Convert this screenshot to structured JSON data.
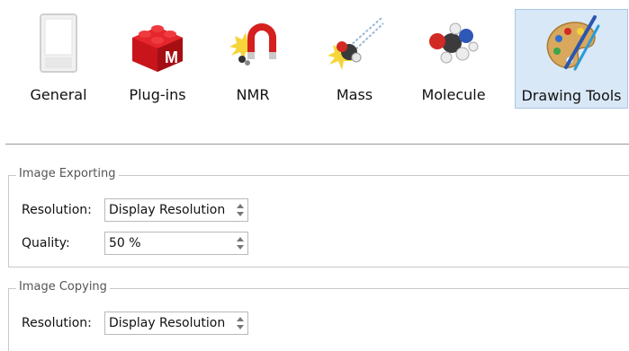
{
  "toolbar": {
    "items": [
      {
        "label": "General",
        "icon": "general-icon",
        "selected": false
      },
      {
        "label": "Plug-ins",
        "icon": "plugins-icon",
        "selected": false
      },
      {
        "label": "NMR",
        "icon": "nmr-icon",
        "selected": false
      },
      {
        "label": "Mass",
        "icon": "mass-icon",
        "selected": false
      },
      {
        "label": "Molecule",
        "icon": "molecule-icon",
        "selected": false
      },
      {
        "label": "Drawing Tools",
        "icon": "drawing-tools-icon",
        "selected": true
      }
    ]
  },
  "image_exporting": {
    "title": "Image Exporting",
    "resolution_label": "Resolution:",
    "resolution_value": "Display Resolution",
    "quality_label": "Quality:",
    "quality_value": "50 %"
  },
  "image_copying": {
    "title": "Image Copying",
    "resolution_label": "Resolution:",
    "resolution_value": "Display Resolution"
  },
  "colors": {
    "selected_bg": "#d9e8f6",
    "selected_border": "#a9c6e3",
    "group_border": "#c8c8c8"
  }
}
